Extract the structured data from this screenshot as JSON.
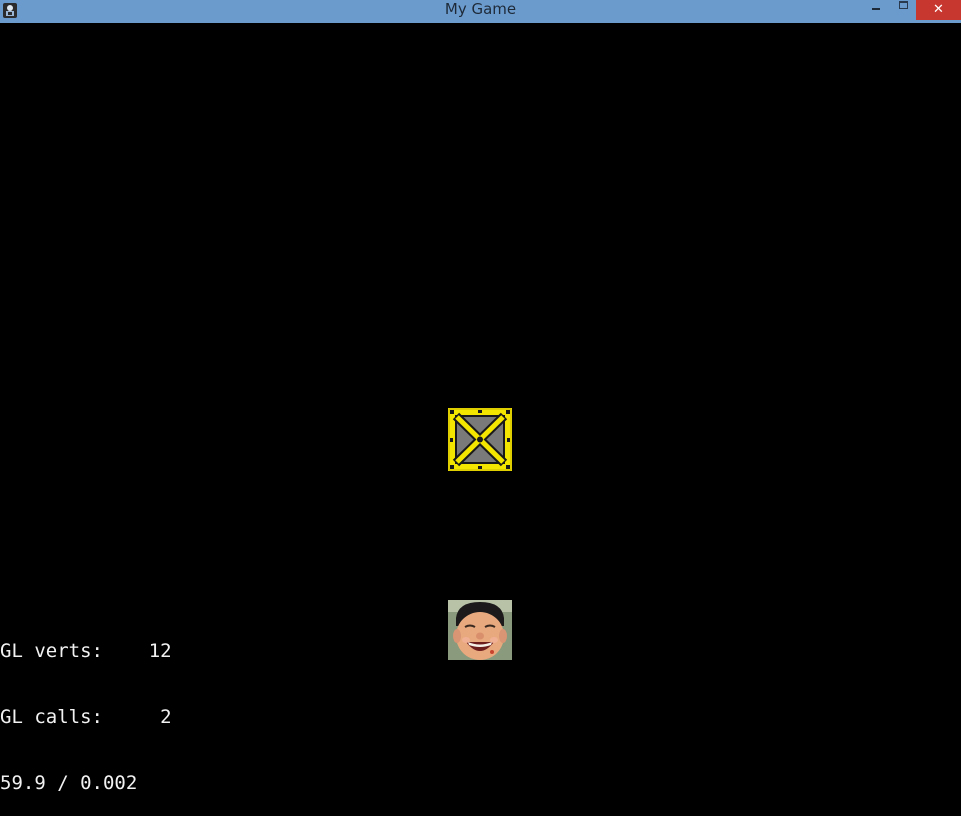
{
  "window": {
    "title": "My Game",
    "app_icon": "game-app-icon",
    "buttons": {
      "minimize_icon": "minimize-icon",
      "maximize_icon": "maximize-icon",
      "close_icon": "close-icon",
      "close_glyph": "✕"
    },
    "colors": {
      "titlebar": "#6b9bcd",
      "close": "#c7372f",
      "canvas": "#000000"
    }
  },
  "scene": {
    "sprites": [
      {
        "name": "crate",
        "colors": {
          "frame": "#f5e600",
          "panel": "#7a7a7a"
        }
      },
      {
        "name": "face"
      }
    ]
  },
  "stats": {
    "lines": [
      "GL verts:    12",
      "GL calls:     2",
      "59.9 / 0.002"
    ]
  }
}
